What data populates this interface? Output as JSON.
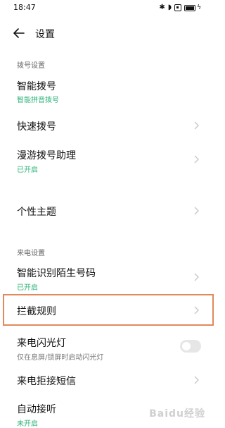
{
  "status_bar": {
    "time": "18:47",
    "icons": [
      "bluetooth-icon",
      "wifi-icon",
      "sim-icon",
      "battery-icon",
      "charging-icon"
    ]
  },
  "header": {
    "back_icon": "arrow-left-icon",
    "title": "设置"
  },
  "sections": {
    "dial": {
      "label": "拨号设置"
    },
    "incoming": {
      "label": "来电设置"
    }
  },
  "rows": {
    "smart_dial": {
      "title": "智能拨号",
      "subtitle": "智能拼音拨号"
    },
    "speed_dial": {
      "title": "快速拨号"
    },
    "roaming_assistant": {
      "title": "漫游拨号助理",
      "subtitle": "已开启"
    },
    "theme": {
      "title": "个性主题"
    },
    "smart_identify": {
      "title": "智能识别陌生号码",
      "subtitle": "已开启"
    },
    "block_rules": {
      "title": "拦截规则"
    },
    "flash_light": {
      "title": "来电闪光灯",
      "subtitle": "仅在息屏/锁屏时启动闪光灯",
      "toggle_on": false
    },
    "reject_sms": {
      "title": "来电拒接短信"
    },
    "auto_answer": {
      "title": "自动接听",
      "subtitle": "未开启"
    }
  },
  "colors": {
    "accent_green": "#2db37a",
    "highlight_orange": "#e08a5b"
  },
  "watermark": "Baidu经验"
}
